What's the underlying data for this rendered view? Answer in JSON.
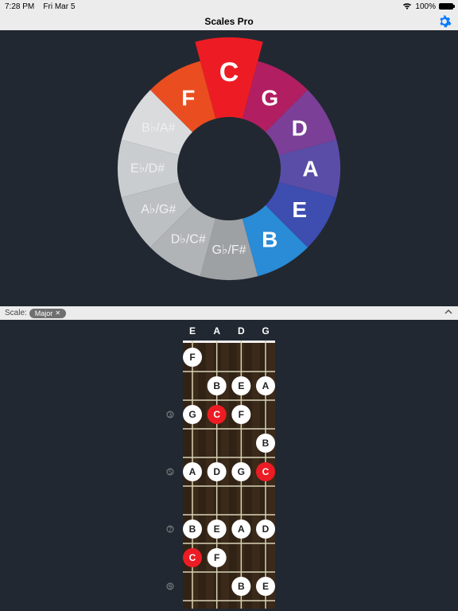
{
  "status": {
    "time": "7:28 PM",
    "date": "Fri Mar 5",
    "battery_pct": "100%"
  },
  "header": {
    "title": "Scales Pro"
  },
  "wheel": {
    "selected_index": 0,
    "segments": [
      {
        "label": "C",
        "color": "#ed1c24",
        "big": true
      },
      {
        "label": "G",
        "color": "#b21e62",
        "big": true
      },
      {
        "label": "D",
        "color": "#7b3f98",
        "big": true
      },
      {
        "label": "A",
        "color": "#5a4da8",
        "big": true
      },
      {
        "label": "E",
        "color": "#3d4db0",
        "big": true
      },
      {
        "label": "B",
        "color": "#2a8bd6",
        "big": true
      },
      {
        "label": "G♭/F#",
        "color": "#9da1a4",
        "big": false
      },
      {
        "label": "D♭/C#",
        "color": "#b0b4b7",
        "big": false
      },
      {
        "label": "A♭/G#",
        "color": "#bcc0c3",
        "big": false
      },
      {
        "label": "E♭/D#",
        "color": "#cacdcf",
        "big": false
      },
      {
        "label": "B♭/A#",
        "color": "#d9dbdc",
        "big": false
      },
      {
        "label": "F",
        "color": "#ea4d1f",
        "big": true
      }
    ]
  },
  "scale_bar": {
    "label": "Scale:",
    "chip": "Major"
  },
  "fretboard": {
    "open_strings": [
      "E",
      "A",
      "D",
      "G"
    ],
    "side_markers": [
      3,
      5,
      7,
      9
    ],
    "board_color": "#3b2a1a",
    "notes": [
      {
        "fret": 1,
        "string": 0,
        "label": "F",
        "root": false
      },
      {
        "fret": 2,
        "string": 1,
        "label": "B",
        "root": false
      },
      {
        "fret": 2,
        "string": 2,
        "label": "E",
        "root": false
      },
      {
        "fret": 2,
        "string": 3,
        "label": "A",
        "root": false
      },
      {
        "fret": 3,
        "string": 0,
        "label": "G",
        "root": false
      },
      {
        "fret": 3,
        "string": 1,
        "label": "C",
        "root": true
      },
      {
        "fret": 3,
        "string": 2,
        "label": "F",
        "root": false
      },
      {
        "fret": 4,
        "string": 3,
        "label": "B",
        "root": false
      },
      {
        "fret": 5,
        "string": 0,
        "label": "A",
        "root": false
      },
      {
        "fret": 5,
        "string": 1,
        "label": "D",
        "root": false
      },
      {
        "fret": 5,
        "string": 2,
        "label": "G",
        "root": false
      },
      {
        "fret": 5,
        "string": 3,
        "label": "C",
        "root": true
      },
      {
        "fret": 7,
        "string": 0,
        "label": "B",
        "root": false
      },
      {
        "fret": 7,
        "string": 1,
        "label": "E",
        "root": false
      },
      {
        "fret": 7,
        "string": 2,
        "label": "A",
        "root": false
      },
      {
        "fret": 7,
        "string": 3,
        "label": "D",
        "root": false
      },
      {
        "fret": 8,
        "string": 0,
        "label": "C",
        "root": true
      },
      {
        "fret": 8,
        "string": 1,
        "label": "F",
        "root": false
      },
      {
        "fret": 9,
        "string": 2,
        "label": "B",
        "root": false
      },
      {
        "fret": 9,
        "string": 3,
        "label": "E",
        "root": false
      }
    ]
  },
  "colors": {
    "root_note": "#ed1c24",
    "scale_note_bg": "#ffffff",
    "scale_note_fg": "#222"
  }
}
